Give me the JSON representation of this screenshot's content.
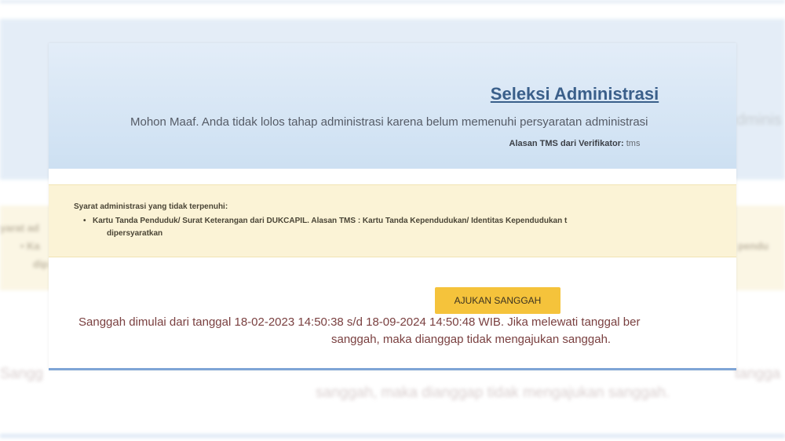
{
  "header": {
    "title": "Seleksi Administrasi",
    "message": "Mohon Maaf. Anda tidak lolos tahap administrasi karena belum memenuhi persyaratan administrasi",
    "reason_label": "Alasan TMS dari Verifikator:",
    "reason_value": "tms"
  },
  "requirements": {
    "title": "Syarat administrasi yang tidak terpenuhi:",
    "items": [
      {
        "line1": "Kartu Tanda Penduduk/ Surat Keterangan dari DUKCAPIL. Alasan TMS : Kartu Tanda Kependudukan/ Identitas Kependudukan t",
        "line2": "dipersyaratkan"
      }
    ]
  },
  "action": {
    "button_label": "AJUKAN SANGGAH",
    "note_line1": "Sanggah dimulai dari tanggal 18-02-2023 14:50:38 s/d 18-09-2024 14:50:48 WIB. Jika melewati tanggal ber",
    "note_line2": "sanggah, maka dianggap tidak mengajukan sanggah."
  },
  "background_fragments": {
    "right_header": "dminis",
    "left_warn_title": "yarat ad",
    "left_warn_item": "• Ka",
    "left_warn_item2": "dip",
    "right_warn_item": "pendu",
    "bottom_line1_left": "Sangg",
    "bottom_line1_right": "tangga",
    "bottom_line2": "sanggah, maka dianggap tidak mengajukan sanggah."
  },
  "colors": {
    "header_bg": "#cde0f2",
    "warning_bg": "#fbf3d6",
    "button_bg": "#f5c33b",
    "title_color": "#3a5f8a",
    "note_color": "#7a4040"
  }
}
